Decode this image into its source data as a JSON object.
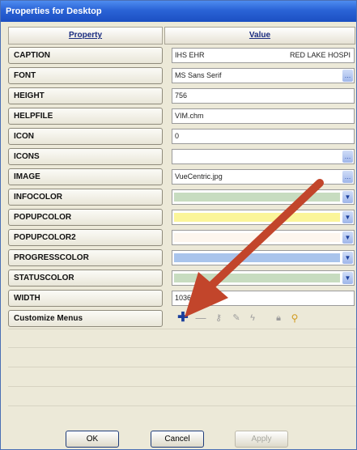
{
  "window": {
    "title": "Properties for Desktop"
  },
  "header": {
    "property": "Property",
    "value": "Value"
  },
  "rows": [
    {
      "property": "CAPTION",
      "value": "IHS EHR",
      "value_right": "RED LAKE HOSPI",
      "kind": "text"
    },
    {
      "property": "FONT",
      "value": "MS Sans Serif",
      "kind": "dropdown"
    },
    {
      "property": "HEIGHT",
      "value": "756",
      "kind": "text"
    },
    {
      "property": "HELPFILE",
      "value": "VIM.chm",
      "kind": "text"
    },
    {
      "property": "ICON",
      "value": "0",
      "kind": "text"
    },
    {
      "property": "ICONS",
      "value": "",
      "kind": "dropdown"
    },
    {
      "property": "IMAGE",
      "value": "VueCentric.jpg",
      "kind": "dropdown"
    },
    {
      "property": "INFOCOLOR",
      "color": "#c7dcc0",
      "kind": "color"
    },
    {
      "property": "POPUPCOLOR",
      "color": "#fbf59a",
      "kind": "color"
    },
    {
      "property": "POPUPCOLOR2",
      "color": "#fdf6ee",
      "kind": "color"
    },
    {
      "property": "PROGRESSCOLOR",
      "color": "#a9c4ec",
      "kind": "color"
    },
    {
      "property": "STATUSCOLOR",
      "color": "#c7dcc0",
      "kind": "color"
    },
    {
      "property": "WIDTH",
      "value": "1036",
      "kind": "text"
    },
    {
      "property": "Customize Menus",
      "kind": "toolbar"
    }
  ],
  "toolbar_icons": [
    "add-icon",
    "remove-icon",
    "key-icon",
    "edit-icon",
    "lightning-icon",
    "lock-icon",
    "magnifier-icon"
  ],
  "buttons": {
    "ok": "OK",
    "cancel": "Cancel",
    "apply": "Apply"
  },
  "colors": {
    "titlebar": "#2a63d6",
    "annotation_arrow": "#c2452b",
    "add_icon": "#1b3f9c"
  }
}
